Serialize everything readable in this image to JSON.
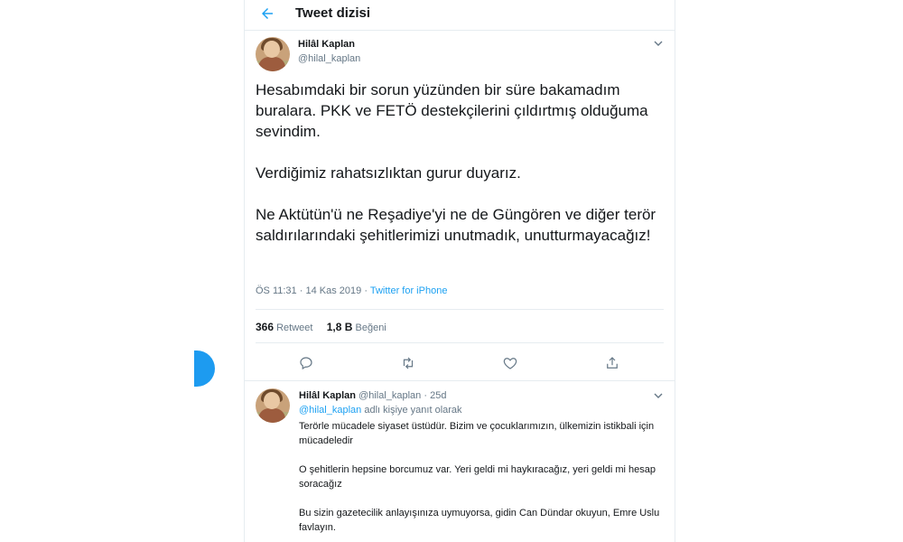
{
  "header": {
    "title": "Tweet dizisi"
  },
  "main_tweet": {
    "name": "Hilâl Kaplan",
    "handle": "@hilal_kaplan",
    "text": "Hesabımdaki bir sorun yüzünden bir süre bakamadım buralara. PKK ve FETÖ destekçilerini çıldırtmış olduğuma sevindim.\n\nVerdiğimiz rahatsızlıktan gurur duyarız.\n\nNe Aktütün'ü ne Reşadiye'yi ne de Güngören ve diğer terör saldırılarındaki şehitlerimizi unutmadık, unutturmayacağız!",
    "time": "ÖS 11:31",
    "separator": "·",
    "date": "14 Kas 2019",
    "source": "Twitter for iPhone",
    "retweet_count": "366",
    "retweet_label": "Retweet",
    "like_count": "1,8 B",
    "like_label": "Beğeni"
  },
  "reply_tweet": {
    "name": "Hilâl Kaplan",
    "handle": "@hilal_kaplan",
    "separator": "·",
    "time": "25d",
    "replying_to": "@hilal_kaplan",
    "replying_suffix": "adlı kişiye yanıt olarak",
    "text": "Terörle mücadele siyaset üstüdür. Bizim ve çocuklarımızın, ülkemizin istikbali için mücadeledir\n\nO şehitlerin hepsine borcumuz var. Yeri geldi mi haykıracağız, yeri geldi mi hesap soracağız\n\nBu sizin gazetecilik anlayışınıza uymuyorsa, gidin Can Dündar okuyun, Emre Uslu favlayın."
  },
  "icons": {
    "back": "back-arrow-icon",
    "menu": "chevron-down-icon",
    "reply": "reply-icon",
    "retweet": "retweet-icon",
    "like": "heart-icon",
    "share": "share-icon"
  },
  "colors": {
    "accent": "#1da1f2",
    "muted": "#657786",
    "text": "#14171a",
    "border": "#e6ecf0"
  }
}
